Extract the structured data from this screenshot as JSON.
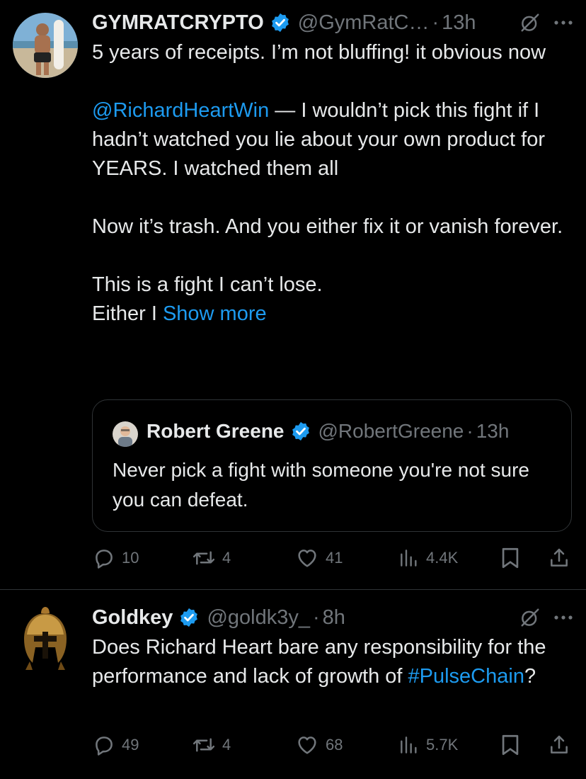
{
  "tweet1": {
    "name": "GYMRATCRYPTO",
    "handle": "@GymRatC…",
    "dot": "·",
    "time": "13h",
    "lines": [
      "5 years of receipts. I’m not bluffing! it obvious now",
      "",
      "@RichardHeartWin",
      " — I wouldn’t pick this fight if I hadn’t watched you lie about your own product for YEARS. I watched them all",
      "",
      "Now it’s trash. And you either fix it or vanish forever.",
      "",
      "This is a fight I can’t lose.",
      "Either I ",
      "Show more"
    ],
    "quote": {
      "name": "Robert Greene",
      "handle": "@RobertGreene",
      "dot": "·",
      "time": "13h",
      "text": "Never pick a fight with someone you're not sure you can defeat."
    },
    "stats": {
      "replies": "10",
      "reposts": "4",
      "likes": "41",
      "views": "4.4K"
    }
  },
  "tweet2": {
    "name": "Goldkey",
    "handle": "@goldk3y_",
    "dot": "·",
    "time": "8h",
    "text": "Does Richard Heart bare any responsibility for the performance and lack of growth of ",
    "hashtag": "#PulseChain",
    "text_end": "?",
    "stats": {
      "replies": "49",
      "reposts": "4",
      "likes": "68",
      "views": "5.7K"
    }
  },
  "colors": {
    "accent": "#1d9bf0",
    "muted": "#71767b",
    "text": "#e7e9ea",
    "background": "#000000"
  }
}
